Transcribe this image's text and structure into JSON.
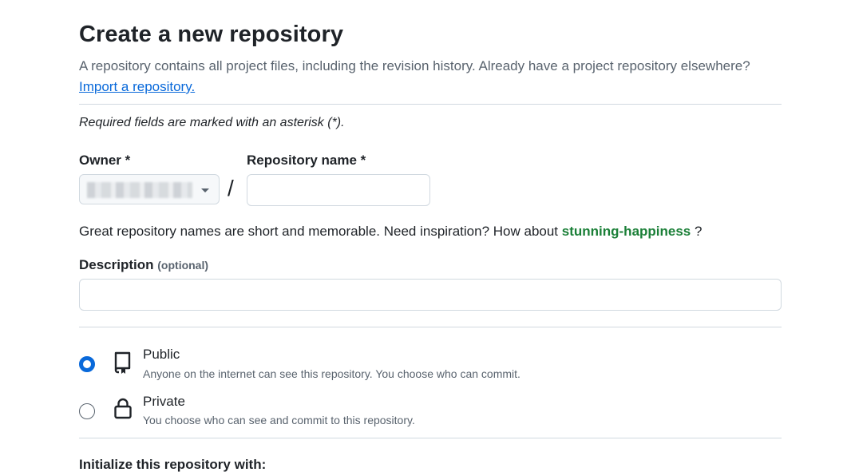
{
  "header": {
    "title": "Create a new repository",
    "intro": "A repository contains all project files, including the revision history. Already have a project repository elsewhere?",
    "import_link": "Import a repository."
  },
  "form": {
    "required_note": "Required fields are marked with an asterisk (*).",
    "owner_label": "Owner *",
    "owner_value": "",
    "separator": "/",
    "repo_name_label": "Repository name *",
    "repo_name_value": "",
    "inspiration_prefix": "Great repository names are short and memorable. Need inspiration? How about",
    "inspiration_suggestion": "stunning-happiness",
    "inspiration_suffix": "?",
    "description_label": "Description",
    "description_optional": "(optional)",
    "description_value": ""
  },
  "visibility": {
    "options": [
      {
        "title": "Public",
        "desc": "Anyone on the internet can see this repository. You choose who can commit.",
        "selected": true,
        "icon": "repo-icon"
      },
      {
        "title": "Private",
        "desc": "You choose who can see and commit to this repository.",
        "selected": false,
        "icon": "lock-icon"
      }
    ]
  },
  "initialize": {
    "label": "Initialize this repository with:"
  },
  "colors": {
    "link": "#0969da",
    "suggestion": "#1a7f37",
    "border": "#d1d9e0",
    "muted": "#59636e"
  }
}
